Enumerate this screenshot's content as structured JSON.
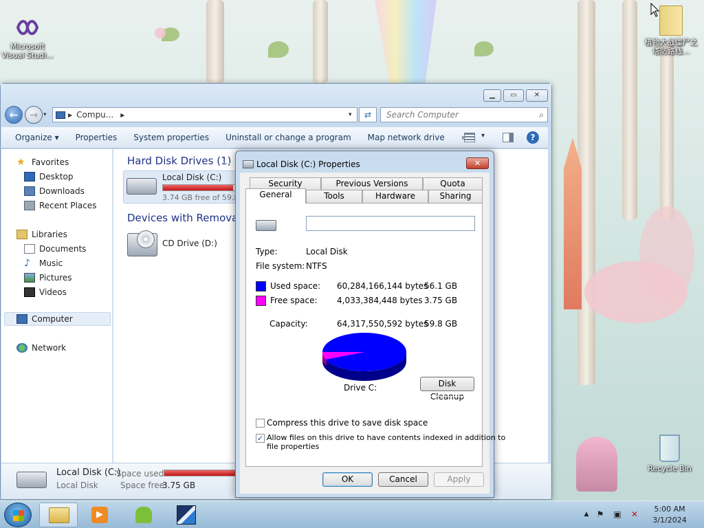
{
  "desktop": {
    "icons": [
      {
        "label": "Microsoft Visual Studi..."
      },
      {
        "label": "植物大战僵尸之塔防路线..."
      },
      {
        "label": "Recycle Bin"
      }
    ]
  },
  "explorer": {
    "address": "Compu...",
    "search_placeholder": "Search Computer",
    "toolbar": {
      "organize": "Organize ▾",
      "properties": "Properties",
      "system_properties": "System properties",
      "uninstall": "Uninstall or change a program",
      "map_drive": "Map network drive",
      "more": "»"
    },
    "nav": {
      "favorites": "Favorites",
      "desktop": "Desktop",
      "downloads": "Downloads",
      "recent": "Recent Places",
      "libraries": "Libraries",
      "documents": "Documents",
      "music": "Music",
      "pictures": "Pictures",
      "videos": "Videos",
      "computer": "Computer",
      "network": "Network"
    },
    "groups": {
      "hdd": "Hard Disk Drives (1)",
      "removable": "Devices with Removable"
    },
    "drives": {
      "c_name": "Local Disk (C:)",
      "c_free": "3.74 GB free of 59.8",
      "c_used_fraction": 0.94,
      "d_name": "CD Drive (D:)"
    },
    "details": {
      "name": "Local Disk (C:)",
      "type": "Local Disk",
      "used_label": "Space used:",
      "free_label": "Space free:",
      "free_value": "3.75 GB"
    }
  },
  "dialog": {
    "title": "Local Disk (C:) Properties",
    "close": "✕",
    "tabs_back": [
      "Security",
      "Previous Versions",
      "Quota"
    ],
    "tabs_front": [
      "General",
      "Tools",
      "Hardware",
      "Sharing"
    ],
    "label_value": "",
    "type_label": "Type:",
    "type_value": "Local Disk",
    "fs_label": "File system:",
    "fs_value": "NTFS",
    "used_label": "Used space:",
    "used_bytes": "60,284,166,144 bytes",
    "used_gb": "56.1 GB",
    "free_label": "Free space:",
    "free_bytes": "4,033,384,448 bytes",
    "free_gb": "3.75 GB",
    "capacity_label": "Capacity:",
    "capacity_bytes": "64,317,550,592 bytes",
    "capacity_gb": "59.8 GB",
    "drive_label": "Drive C:",
    "cleanup": "Disk Cleanup",
    "compress": "Compress this drive to save disk space",
    "index_line1": "Allow files on this drive to have contents indexed in addition to",
    "index_line2": "file properties",
    "index_checked": "✓",
    "ok": "OK",
    "cancel": "Cancel",
    "apply": "Apply",
    "used_color": "#0000ff",
    "free_color": "#ff00ff"
  },
  "taskbar": {
    "time": "5:00 AM",
    "date": "3/1/2024"
  }
}
